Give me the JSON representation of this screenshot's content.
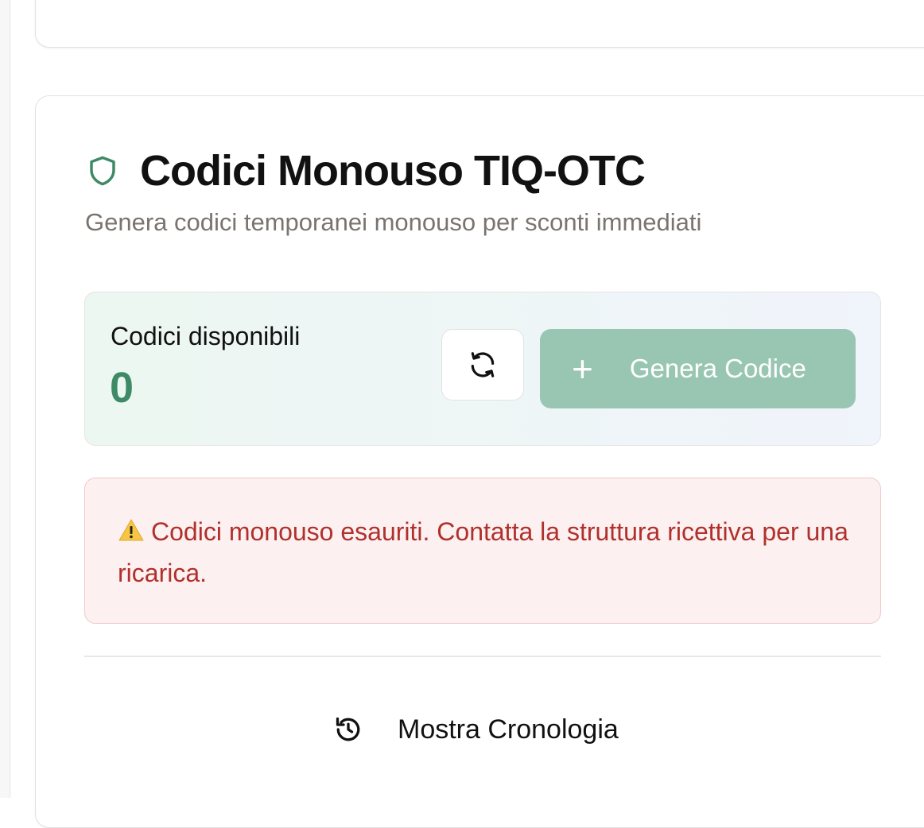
{
  "card": {
    "title": "Codici Monouso TIQ-OTC",
    "subtitle": "Genera codici temporanei monouso per sconti immediati"
  },
  "available": {
    "label": "Codici disponibili",
    "count": "0"
  },
  "actions": {
    "refresh_icon": "refresh-icon",
    "generate_icon": "plus",
    "generate_label": "Genera Codice"
  },
  "alert": {
    "icon": "warning-icon",
    "message": "Codici monouso esauriti. Contatta la struttura ricettiva per una ricarica."
  },
  "history": {
    "icon": "history-icon",
    "label": "Mostra Cronologia"
  },
  "colors": {
    "accent_green": "#3f8a66",
    "button_green_disabled": "#98c6b2",
    "alert_text": "#b0302c",
    "alert_bg": "#fcf0f0"
  }
}
